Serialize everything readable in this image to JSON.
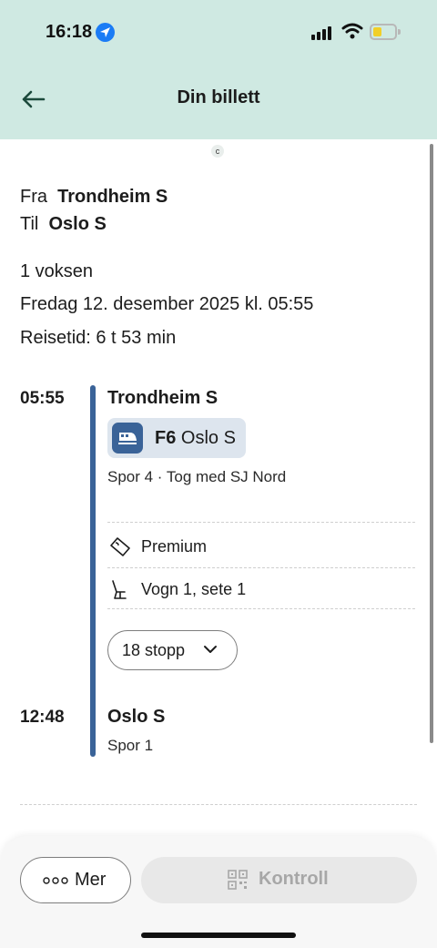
{
  "status_bar": {
    "time": "16:18"
  },
  "header": {
    "title": "Din billett"
  },
  "indicator": {
    "letter": "c"
  },
  "route": {
    "from_label": "Fra",
    "from_station": "Trondheim S",
    "to_label": "Til",
    "to_station": "Oslo S"
  },
  "trip": {
    "passengers": "1 voksen",
    "date": "Fredag 12. desember 2025 kl. 05:55",
    "duration": "Reisetid: 6 t 53 min"
  },
  "journey": {
    "departure": {
      "time": "05:55",
      "station": "Trondheim S",
      "detail": "Spor 4 · Tog med SJ Nord"
    },
    "train": {
      "line": "F6",
      "destination": "Oslo S"
    },
    "class": "Premium",
    "seat": "Vogn 1, sete 1",
    "stops_label": "18 stopp",
    "arrival": {
      "time": "12:48",
      "station": "Oslo S",
      "detail": "Spor 1"
    }
  },
  "actions": {
    "more_label": "Mer",
    "control_label": "Kontroll"
  },
  "colors": {
    "header_bg": "#cfe9e2",
    "timeline": "#3a6398",
    "train_chip_bg": "#dde5ee"
  }
}
